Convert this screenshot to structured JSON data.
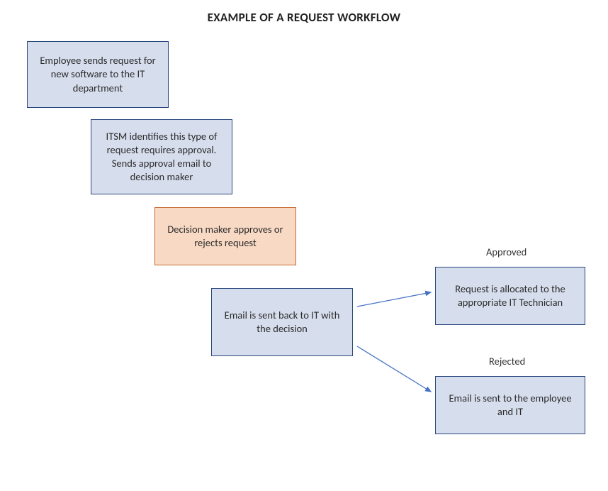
{
  "title": "EXAMPLE OF A REQUEST WORKFLOW",
  "boxes": {
    "step1": "Employee sends request for new software to the IT department",
    "step2": "ITSM identifies this type of request requires approval. Sends approval email to decision maker",
    "step3": "Decision maker approves or rejects request",
    "step4": "Email is sent back to IT with the decision",
    "approved": "Request is allocated to the appropriate IT Technician",
    "rejected": "Email is sent to the employee and IT"
  },
  "labels": {
    "approved": "Approved",
    "rejected": "Rejected"
  },
  "colors": {
    "blueFill": "#d6dded",
    "blueBorder": "#28477e",
    "orangeFill": "#f8d9c4",
    "orangeBorder": "#c86a33",
    "arrow": "#4472c4"
  }
}
